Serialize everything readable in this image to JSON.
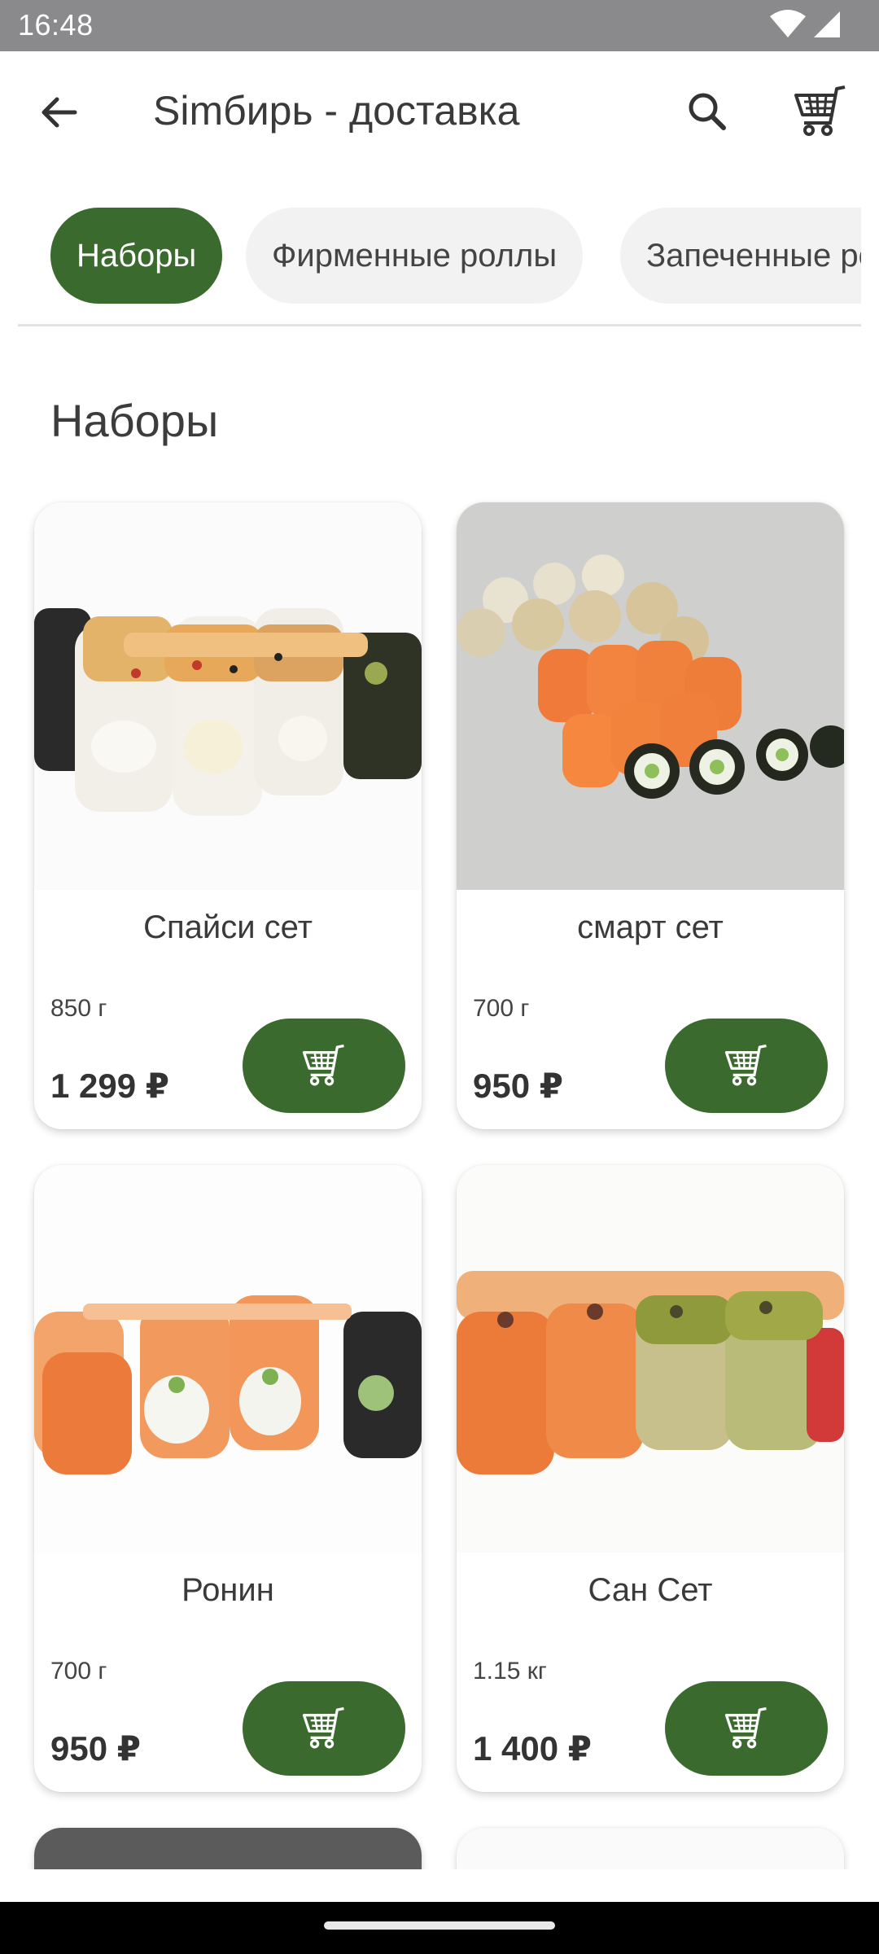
{
  "status_bar": {
    "time": "16:48"
  },
  "app_bar": {
    "title": "Simбирь - доставка"
  },
  "categories": [
    {
      "label": "Наборы",
      "active": true
    },
    {
      "label": "Фирменные роллы",
      "active": false
    },
    {
      "label": "Запеченные роллы",
      "active": false
    }
  ],
  "section_title": "Наборы",
  "products": [
    {
      "name": "Спайси сет",
      "weight": "850 г",
      "price": "1 299 ₽"
    },
    {
      "name": "смарт сет",
      "weight": "700 г",
      "price": "950 ₽"
    },
    {
      "name": "Ронин",
      "weight": "700 г",
      "price": "950 ₽"
    },
    {
      "name": "Сан Сет",
      "weight": "1.15 кг",
      "price": "1 400 ₽"
    }
  ],
  "colors": {
    "accent": "#3a6a2d",
    "status_bar": "#8a8a8c"
  }
}
